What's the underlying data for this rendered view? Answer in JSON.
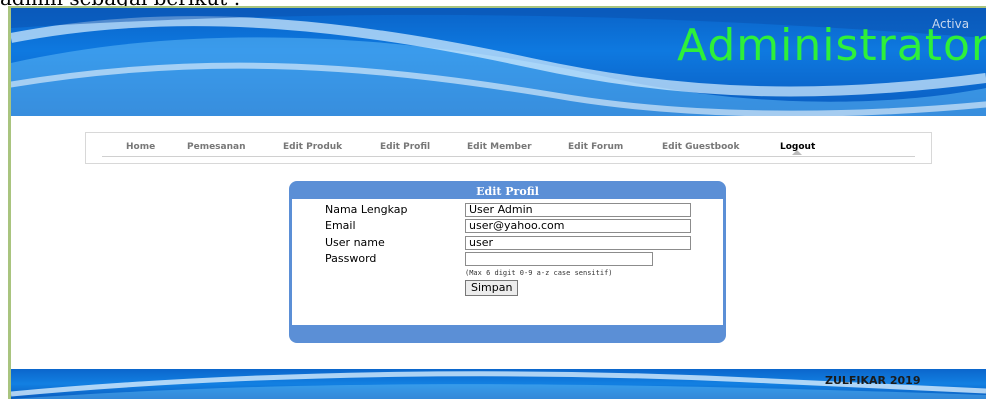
{
  "caption": "admin sebagai berikut :",
  "header": {
    "title": "Administrator"
  },
  "nav": {
    "items": [
      {
        "label": "Home"
      },
      {
        "label": "Pemesanan"
      },
      {
        "label": "Edit Produk"
      },
      {
        "label": "Edit Profil"
      },
      {
        "label": "Edit Member"
      },
      {
        "label": "Edit Forum"
      },
      {
        "label": "Edit Guestbook"
      },
      {
        "label": "Logout"
      }
    ],
    "active": "Logout"
  },
  "form": {
    "title": "Edit Profil",
    "fields": {
      "nama_label": "Nama Lengkap",
      "nama_value": "User Admin",
      "email_label": "Email",
      "email_value": "user@yahoo.com",
      "username_label": "User name",
      "username_value": "user",
      "password_label": "Password",
      "password_value": ""
    },
    "hint": "(Max 6 digit 0-9 a-z case sensitif)",
    "submit_label": "Simpan"
  },
  "footer": {
    "text": "ZULFIKAR 2019",
    "overlay": "Activa"
  },
  "colors": {
    "header_blue": "#0e79e0",
    "title_green": "#2ef03a",
    "panel_blue": "#5b8fd6"
  }
}
